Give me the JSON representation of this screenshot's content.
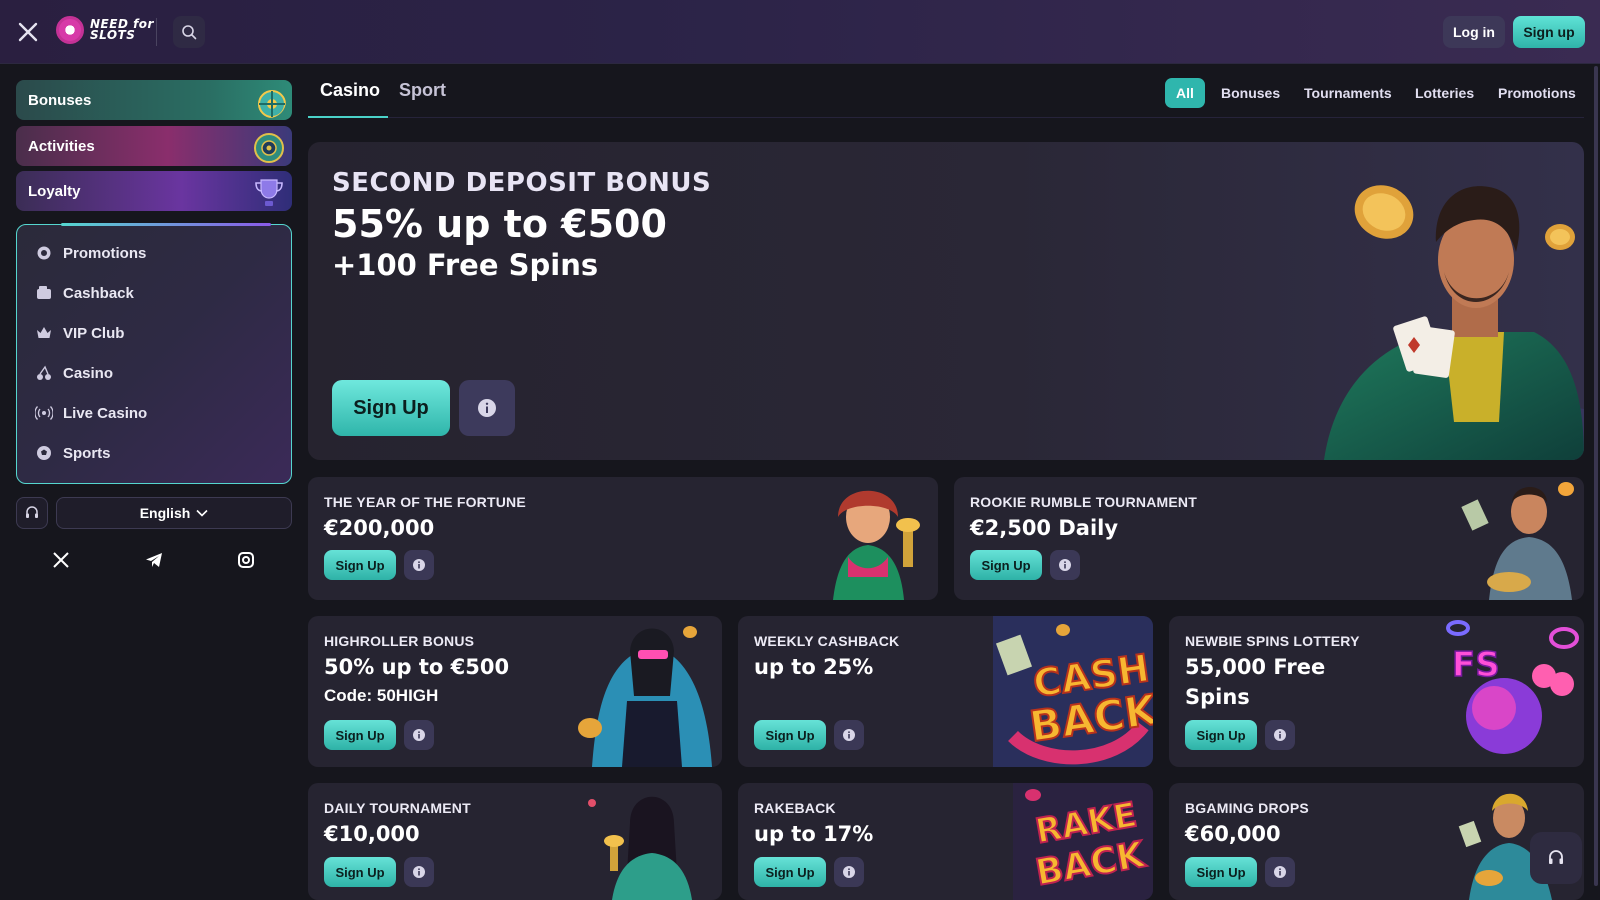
{
  "header": {
    "logo_line1": "NEED for",
    "logo_line2": "SLOTS",
    "login_label": "Log in",
    "signup_label": "Sign up"
  },
  "sidebar": {
    "categories": [
      {
        "label": "Bonuses",
        "icon": "bonus-wheel-icon"
      },
      {
        "label": "Activities",
        "icon": "activities-wheel-icon"
      },
      {
        "label": "Loyalty",
        "icon": "trophy-icon"
      }
    ],
    "menu": [
      {
        "label": "Promotions",
        "icon": "gear-icon"
      },
      {
        "label": "Cashback",
        "icon": "wallet-icon"
      },
      {
        "label": "VIP Club",
        "icon": "crown-icon"
      },
      {
        "label": "Casino",
        "icon": "cherries-icon"
      },
      {
        "label": "Live Casino",
        "icon": "broadcast-icon"
      },
      {
        "label": "Sports",
        "icon": "soccer-ball-icon"
      }
    ],
    "language": "English"
  },
  "tabs": {
    "main": [
      "Casino",
      "Sport"
    ],
    "active": "Casino",
    "filters": [
      "All",
      "Bonuses",
      "Tournaments",
      "Lotteries",
      "Promotions"
    ],
    "active_filter": "All"
  },
  "hero": {
    "eyebrow": "SECOND DEPOSIT BONUS",
    "title": "55% up to €500",
    "subtitle": "+100 Free Spins",
    "cta": "Sign Up"
  },
  "cards": [
    {
      "title": "THE YEAR OF THE FORTUNE",
      "value": "€200,000",
      "extra": "",
      "cta": "Sign Up"
    },
    {
      "title": "ROOKIE RUMBLE TOURNAMENT",
      "value": "€2,500 Daily",
      "extra": "",
      "cta": "Sign Up"
    },
    {
      "title": "HIGHROLLER BONUS",
      "value": "50% up to €500",
      "extra": "Code: 50HIGH",
      "cta": "Sign Up"
    },
    {
      "title": "WEEKLY CASHBACK",
      "value": "up to 25%",
      "extra": "",
      "cta": "Sign Up"
    },
    {
      "title": "NEWBIE SPINS LOTTERY",
      "value": "55,000 Free Spins",
      "extra": "",
      "cta": "Sign Up"
    },
    {
      "title": "DAILY TOURNAMENT",
      "value": "€10,000",
      "extra": "",
      "cta": "Sign Up"
    },
    {
      "title": "RAKEBACK",
      "value": "up to 17%",
      "extra": "",
      "cta": "Sign Up"
    },
    {
      "title": "BGAMING DROPS",
      "value": "€60,000",
      "extra": "",
      "cta": "Sign Up"
    }
  ],
  "art_text": {
    "cashback_word_1": "CASH",
    "cashback_word_2": "BACK",
    "rakeback_word_1": "RAKE",
    "rakeback_word_2": "BACK",
    "free_spins_badge": "FS"
  },
  "colors": {
    "accent": "#2fb6ad",
    "background": "#16161d",
    "card": "#262431"
  }
}
